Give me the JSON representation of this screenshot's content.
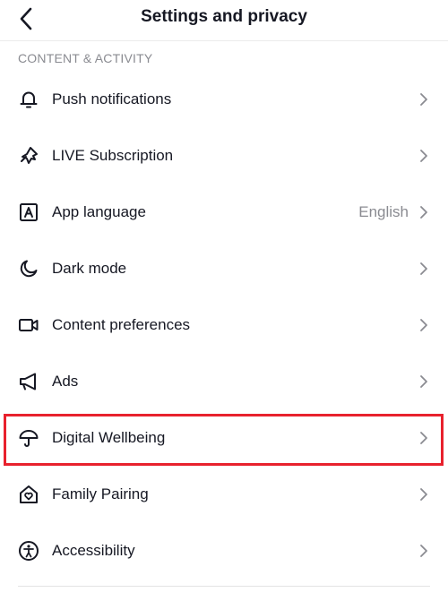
{
  "header": {
    "title": "Settings and privacy"
  },
  "section": {
    "title": "CONTENT & ACTIVITY"
  },
  "items": [
    {
      "label": "Push notifications",
      "icon": "bell-icon"
    },
    {
      "label": "LIVE Subscription",
      "icon": "live-subscription-icon"
    },
    {
      "label": "App language",
      "icon": "language-icon",
      "value": "English"
    },
    {
      "label": "Dark mode",
      "icon": "moon-icon"
    },
    {
      "label": "Content preferences",
      "icon": "video-camera-icon"
    },
    {
      "label": "Ads",
      "icon": "megaphone-icon"
    },
    {
      "label": "Digital Wellbeing",
      "icon": "umbrella-icon",
      "highlighted": true
    },
    {
      "label": "Family Pairing",
      "icon": "home-heart-icon"
    },
    {
      "label": "Accessibility",
      "icon": "accessibility-icon"
    }
  ],
  "colors": {
    "highlight": "#e8212d",
    "text": "#161823",
    "secondary": "#8a8b91"
  }
}
